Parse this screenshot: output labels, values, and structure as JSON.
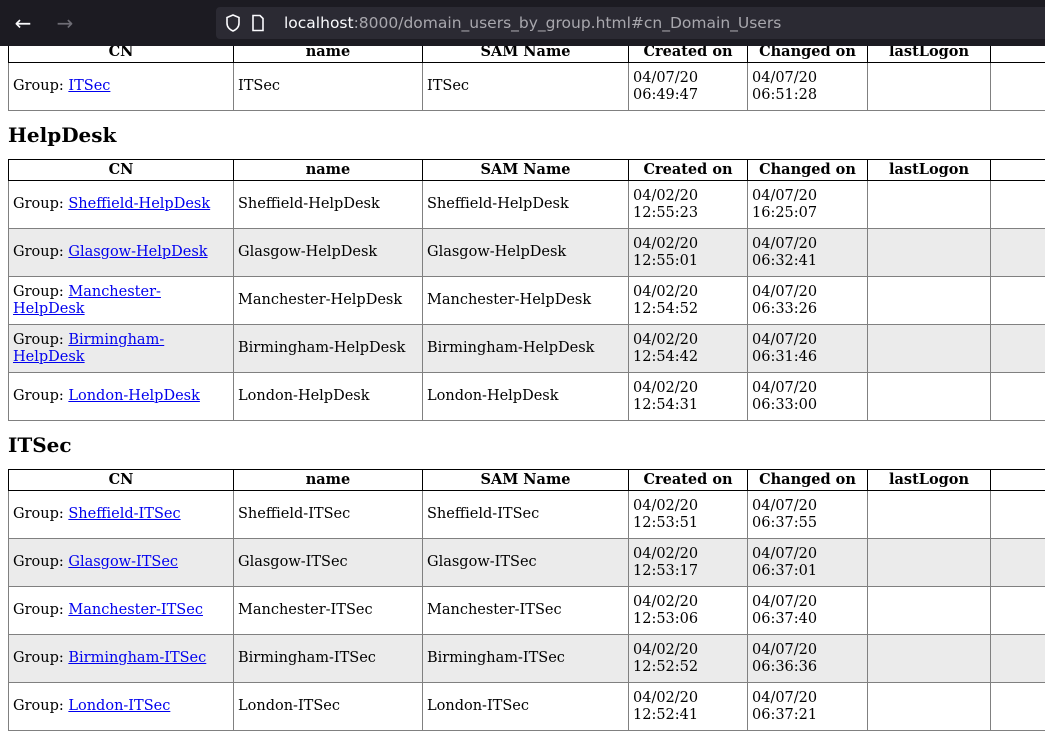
{
  "browser": {
    "back_icon": "←",
    "forward_icon": "→",
    "url_host": "localhost",
    "url_rest": ":8000/domain_users_by_group.html#cn_Domain_Users"
  },
  "columns": [
    "CN",
    "name",
    "SAM Name",
    "Created on",
    "Changed on",
    "lastLogon",
    ""
  ],
  "top_table": {
    "rows": [
      {
        "prefix": "Group: ",
        "cn": "ITSec",
        "name": "ITSec",
        "sam": "ITSec",
        "created_date": "04/07/20",
        "created_time": "06:49:47",
        "changed_date": "04/07/20",
        "changed_time": "06:51:28",
        "last_logon": ""
      }
    ]
  },
  "sections": [
    {
      "title": "HelpDesk",
      "rows": [
        {
          "prefix": "Group: ",
          "cn": "Sheffield-HelpDesk",
          "name": "Sheffield-HelpDesk",
          "sam": "Sheffield-HelpDesk",
          "created_date": "04/02/20",
          "created_time": "12:55:23",
          "changed_date": "04/07/20",
          "changed_time": "16:25:07",
          "last_logon": ""
        },
        {
          "prefix": "Group: ",
          "cn": "Glasgow-HelpDesk",
          "name": "Glasgow-HelpDesk",
          "sam": "Glasgow-HelpDesk",
          "created_date": "04/02/20",
          "created_time": "12:55:01",
          "changed_date": "04/07/20",
          "changed_time": "06:32:41",
          "last_logon": ""
        },
        {
          "prefix": "Group: ",
          "cn": "Manchester-HelpDesk",
          "name": "Manchester-HelpDesk",
          "sam": "Manchester-HelpDesk",
          "created_date": "04/02/20",
          "created_time": "12:54:52",
          "changed_date": "04/07/20",
          "changed_time": "06:33:26",
          "last_logon": ""
        },
        {
          "prefix": "Group: ",
          "cn": "Birmingham-HelpDesk",
          "name": "Birmingham-HelpDesk",
          "sam": "Birmingham-HelpDesk",
          "created_date": "04/02/20",
          "created_time": "12:54:42",
          "changed_date": "04/07/20",
          "changed_time": "06:31:46",
          "last_logon": ""
        },
        {
          "prefix": "Group: ",
          "cn": "London-HelpDesk",
          "name": "London-HelpDesk",
          "sam": "London-HelpDesk",
          "created_date": "04/02/20",
          "created_time": "12:54:31",
          "changed_date": "04/07/20",
          "changed_time": "06:33:00",
          "last_logon": ""
        }
      ]
    },
    {
      "title": "ITSec",
      "rows": [
        {
          "prefix": "Group: ",
          "cn": "Sheffield-ITSec",
          "name": "Sheffield-ITSec",
          "sam": "Sheffield-ITSec",
          "created_date": "04/02/20",
          "created_time": "12:53:51",
          "changed_date": "04/07/20",
          "changed_time": "06:37:55",
          "last_logon": ""
        },
        {
          "prefix": "Group: ",
          "cn": "Glasgow-ITSec",
          "name": "Glasgow-ITSec",
          "sam": "Glasgow-ITSec",
          "created_date": "04/02/20",
          "created_time": "12:53:17",
          "changed_date": "04/07/20",
          "changed_time": "06:37:01",
          "last_logon": ""
        },
        {
          "prefix": "Group: ",
          "cn": "Manchester-ITSec",
          "name": "Manchester-ITSec",
          "sam": "Manchester-ITSec",
          "created_date": "04/02/20",
          "created_time": "12:53:06",
          "changed_date": "04/07/20",
          "changed_time": "06:37:40",
          "last_logon": ""
        },
        {
          "prefix": "Group: ",
          "cn": "Birmingham-ITSec",
          "name": "Birmingham-ITSec",
          "sam": "Birmingham-ITSec",
          "created_date": "04/02/20",
          "created_time": "12:52:52",
          "changed_date": "04/07/20",
          "changed_time": "06:36:36",
          "last_logon": ""
        },
        {
          "prefix": "Group: ",
          "cn": "London-ITSec",
          "name": "London-ITSec",
          "sam": "London-ITSec",
          "created_date": "04/02/20",
          "created_time": "12:52:41",
          "changed_date": "04/07/20",
          "changed_time": "06:37:21",
          "last_logon": ""
        }
      ]
    }
  ]
}
